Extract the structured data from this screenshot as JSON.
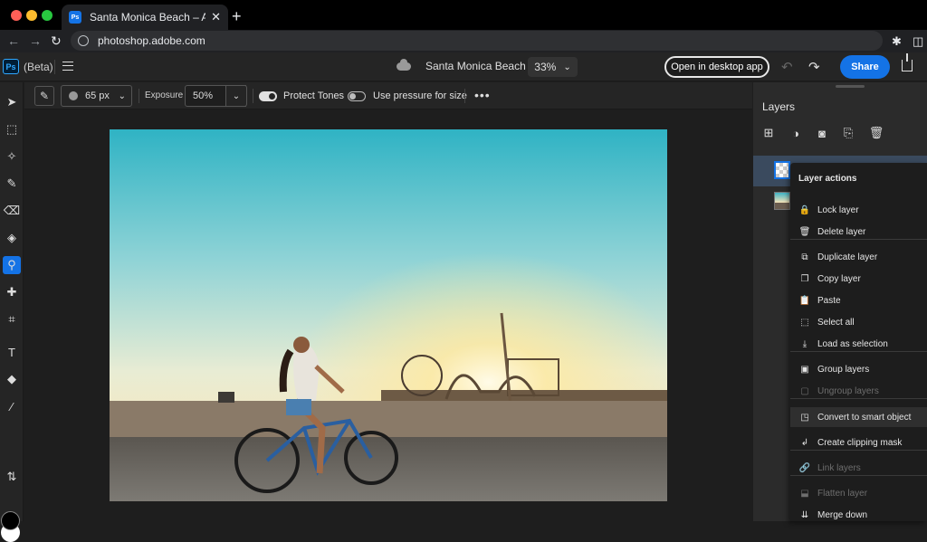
{
  "browser": {
    "tab_title": "Santa Monica Beach – Adobe P",
    "favicon_label": "Ps",
    "url": "photoshop.adobe.com",
    "traffic_colors": [
      "#ff5f57",
      "#febc2e",
      "#28c840"
    ]
  },
  "app": {
    "logo": "Ps",
    "beta_label": "(Beta)",
    "document_title": "Santa Monica Beach",
    "zoom": "33%",
    "open_desktop_label": "Open in desktop app",
    "share_label": "Share",
    "accent_color": "#1473e6"
  },
  "toolbar": {
    "tools": [
      {
        "name": "move-icon",
        "glyph": "➤"
      },
      {
        "name": "transform-icon",
        "glyph": "⬚"
      },
      {
        "name": "quick-select-icon",
        "glyph": "✧"
      },
      {
        "name": "brush-icon",
        "glyph": "✎"
      },
      {
        "name": "eraser-icon",
        "glyph": "⌫"
      },
      {
        "name": "paint-bucket-icon",
        "glyph": "◈"
      },
      {
        "name": "dodge-icon",
        "glyph": "⚲"
      },
      {
        "name": "healing-icon",
        "glyph": "✚"
      },
      {
        "name": "crop-icon",
        "glyph": "⌗"
      },
      {
        "name": "type-icon",
        "glyph": "T"
      },
      {
        "name": "shapes-icon",
        "glyph": "◆"
      },
      {
        "name": "eyedropper-icon",
        "glyph": "⁄"
      }
    ],
    "active_tool": "dodge-icon",
    "swap_glyph": "⇅"
  },
  "options": {
    "brush_size": "65 px",
    "exposure_label": "Exposure",
    "exposure_value": "50%",
    "protect_tones_label": "Protect Tones",
    "protect_tones_on": true,
    "pressure_label": "Use pressure for size",
    "pressure_on": false,
    "more_glyph": "•••"
  },
  "layers_panel": {
    "title": "Layers",
    "icons": [
      "add-layer-icon",
      "adjustment-icon",
      "mask-icon",
      "import-icon",
      "trash-icon"
    ]
  },
  "context_menu": {
    "title": "Layer actions",
    "items": [
      {
        "label": "Lock layer",
        "icon": "lock-icon",
        "glyph": "🔒",
        "disabled": false
      },
      {
        "label": "Delete layer",
        "icon": "trash-icon",
        "glyph": "🗑",
        "disabled": false
      },
      {
        "label": "Duplicate layer",
        "icon": "duplicate-icon",
        "glyph": "⧉",
        "disabled": false
      },
      {
        "label": "Copy layer",
        "icon": "copy-icon",
        "glyph": "❐",
        "disabled": false
      },
      {
        "label": "Paste",
        "icon": "paste-icon",
        "glyph": "📋",
        "disabled": false
      },
      {
        "label": "Select all",
        "icon": "select-all-icon",
        "glyph": "⬚",
        "disabled": false
      },
      {
        "label": "Load as selection",
        "icon": "load-selection-icon",
        "glyph": "⤓",
        "disabled": false
      },
      {
        "label": "Group layers",
        "icon": "group-icon",
        "glyph": "▣",
        "disabled": false
      },
      {
        "label": "Ungroup layers",
        "icon": "ungroup-icon",
        "glyph": "▢",
        "disabled": true
      },
      {
        "label": "Convert to smart object",
        "icon": "smart-object-icon",
        "glyph": "◳",
        "disabled": false
      },
      {
        "label": "Create clipping mask",
        "icon": "clipping-mask-icon",
        "glyph": "↲",
        "disabled": false
      },
      {
        "label": "Link layers",
        "icon": "link-icon",
        "glyph": "🔗",
        "disabled": true
      },
      {
        "label": "Flatten layer",
        "icon": "flatten-icon",
        "glyph": "⬓",
        "disabled": true
      },
      {
        "label": "Merge down",
        "icon": "merge-down-icon",
        "glyph": "⇊",
        "disabled": false
      }
    ]
  }
}
